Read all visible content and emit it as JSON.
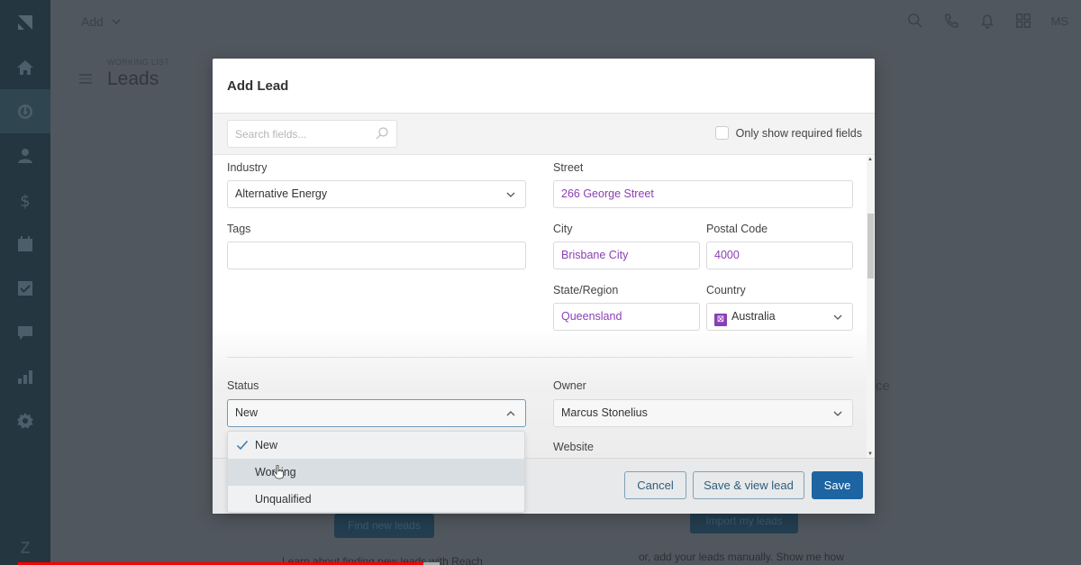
{
  "app": {
    "topbar": {
      "add_label": "Add",
      "user_initials": "MS"
    },
    "page": {
      "subtitle": "WORKING LIST",
      "title": "Leads"
    },
    "background": {
      "find_leads_button": "Find new leads",
      "import_leads_button": "Import my leads",
      "learn_text": "Learn about finding new leads with Reach",
      "manual_text": "or, add your leads manually. Show me how",
      "partial_text": "ce"
    },
    "sidebar": {
      "items": [
        {
          "name": "home",
          "icon": "home-icon"
        },
        {
          "name": "leads",
          "icon": "leads-icon",
          "active": true
        },
        {
          "name": "contacts",
          "icon": "person-icon"
        },
        {
          "name": "deals",
          "icon": "dollar-icon"
        },
        {
          "name": "calendar",
          "icon": "calendar-icon"
        },
        {
          "name": "tasks",
          "icon": "checkbox-icon"
        },
        {
          "name": "messages",
          "icon": "chat-icon"
        },
        {
          "name": "reports",
          "icon": "bar-chart-icon"
        },
        {
          "name": "settings",
          "icon": "gear-icon"
        }
      ]
    },
    "video_progress": 0.37
  },
  "modal": {
    "title": "Add Lead",
    "search_placeholder": "Search fields...",
    "required_only_label": "Only show required fields",
    "required_only_checked": false,
    "fields": {
      "industry": {
        "label": "Industry",
        "value": "Alternative Energy"
      },
      "tags": {
        "label": "Tags",
        "value": ""
      },
      "street": {
        "label": "Street",
        "value": "266 George Street"
      },
      "city": {
        "label": "City",
        "value": "Brisbane City"
      },
      "postal_code": {
        "label": "Postal Code",
        "value": "4000"
      },
      "state": {
        "label": "State/Region",
        "value": "Queensland"
      },
      "country": {
        "label": "Country",
        "value": "Australia"
      },
      "status": {
        "label": "Status",
        "value": "New"
      },
      "owner": {
        "label": "Owner",
        "value": "Marcus Stonelius"
      },
      "website": {
        "label": "Website"
      }
    },
    "status_options": [
      {
        "label": "New",
        "selected": true
      },
      {
        "label": "Working",
        "hovered": true
      },
      {
        "label": "Unqualified"
      }
    ],
    "buttons": {
      "cancel": "Cancel",
      "save_view": "Save & view lead",
      "save": "Save"
    }
  },
  "colors": {
    "accent_blue": "#1c64a2",
    "value_purple": "#8a3fb4",
    "sidebar_bg": "#243640",
    "progress_red": "#ff0000"
  }
}
